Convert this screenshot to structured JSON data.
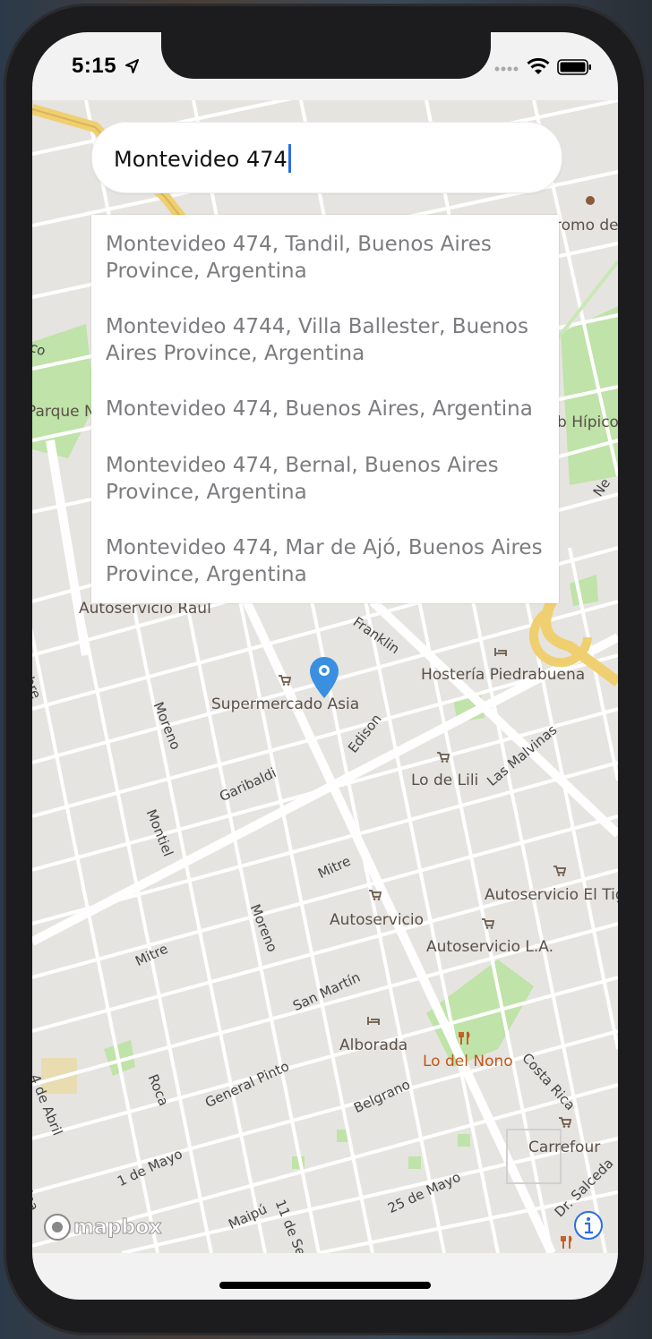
{
  "status_bar": {
    "time": "5:15"
  },
  "search": {
    "value": "Montevideo 474"
  },
  "suggestions": [
    {
      "line1": "Montevideo 474, Tandil, Buenos Aires",
      "line2": "Province, Argentina"
    },
    {
      "line1": "Montevideo 4744, Villa Ballester, Buenos",
      "line2": "Aires Province, Argentina"
    },
    {
      "line1": "Montevideo 474, Buenos Aires, Argentina",
      "line2": ""
    },
    {
      "line1": "Montevideo 474, Bernal, Buenos Aires",
      "line2": "Province, Argentina"
    },
    {
      "line1": "Montevideo 474, Mar de Ajó, Buenos Aires",
      "line2": "Province, Argentina"
    }
  ],
  "map": {
    "pois": {
      "autoservicio_raul": "Autoservicio Raul",
      "hosteria": "Hostería Piedrabuena",
      "supermercado": "Supermercado Asia",
      "lo_de_lili": "Lo de Lili",
      "autoservicio_el_tigre": "Autoservicio El Tig",
      "autoservicio": "Autoservicio",
      "autoservicio_la": "Autoservicio L.A.",
      "alborada": "Alborada",
      "lo_del_nono": "Lo del Nono",
      "carrefour": "Carrefour",
      "hipodromo": "romo de",
      "club_hipico": "b Hípico",
      "parque": "Parque N"
    },
    "streets": {
      "franklin": "Franklin",
      "edison": "Edison",
      "moreno_1": "Moreno",
      "moreno_2": "Moreno",
      "montiel": "Montiel",
      "garibaldi": "Garibaldi",
      "mitre_1": "Mitre",
      "mitre_2": "Mitre",
      "las_malvinas": "Las Malvinas",
      "san_martin": "San Martín",
      "general_pinto": "General Pinto",
      "belgrano": "Belgrano",
      "roca": "Roca",
      "cuatro_abril": "4 de Abril",
      "uno_mayo": "1 de Mayo",
      "maipu": "Maipú",
      "once_sept": "11 de Sept",
      "veinticinco_mayo": "25 de Mayo",
      "costa_rica": "Costa Rica",
      "dr_salceda": "Dr. Salceda",
      "ne": "Ne",
      "ore": "bre",
      "ina": "ina",
      "co": "co"
    },
    "attribution": "mapbox"
  },
  "colors": {
    "accent": "#2a6ee5",
    "pin": "#3b8fe0",
    "map_bg": "#e6e4e0",
    "park": "#bfe3a8",
    "highway": "#f0cf70",
    "poi_orange": "#c2571a"
  }
}
